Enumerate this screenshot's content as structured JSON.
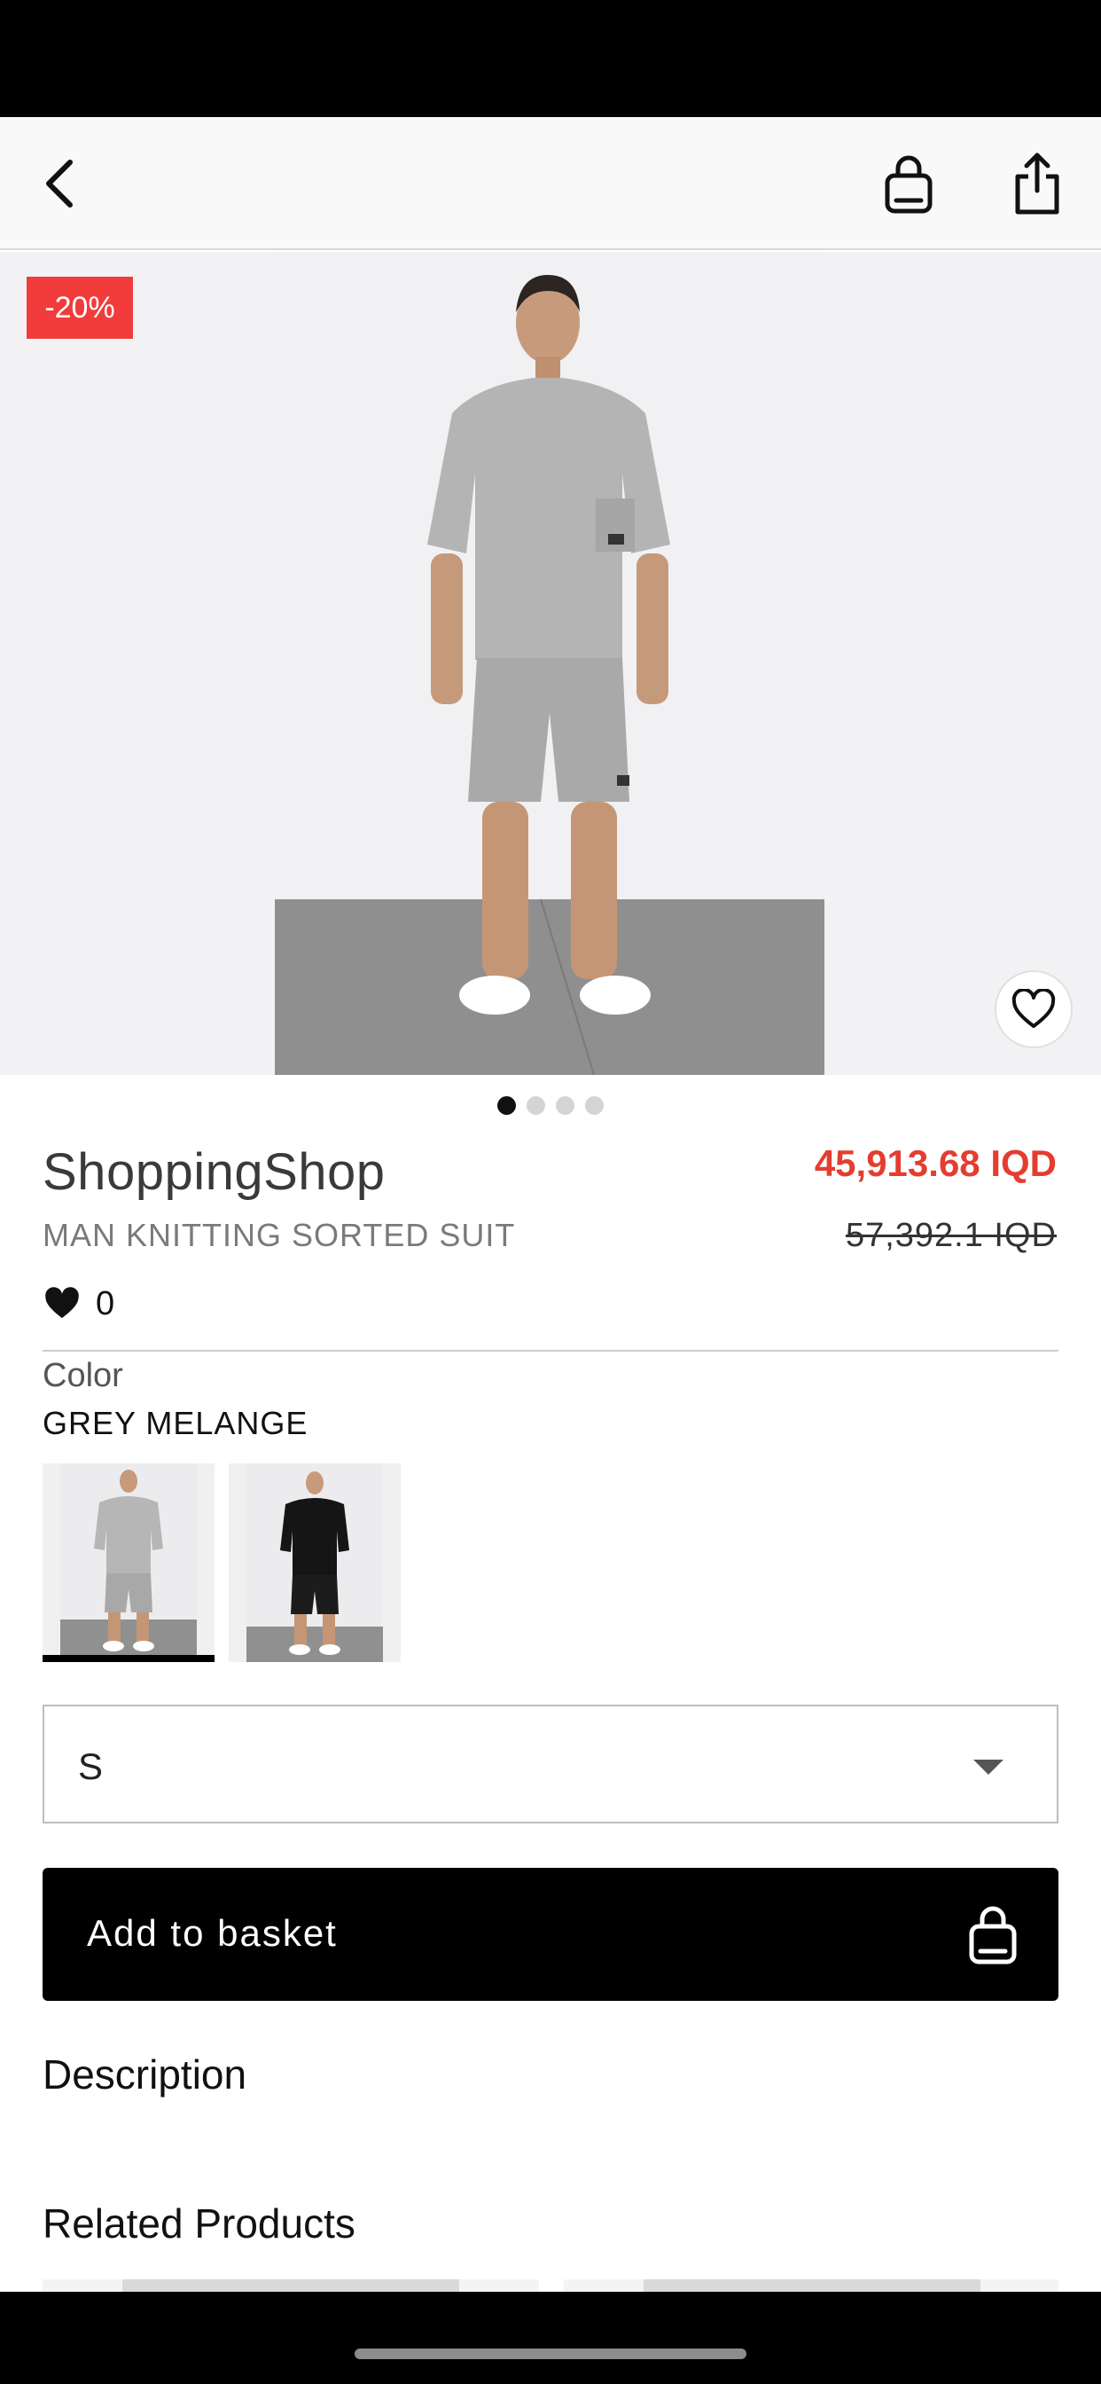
{
  "header": {
    "icons": [
      "chevron-left-icon",
      "shopping-bag-icon",
      "share-icon"
    ]
  },
  "hero": {
    "discount_badge": "-20%",
    "image_count": 4,
    "active_image": 1
  },
  "product": {
    "brand": "ShoppingShop",
    "name": "MAN KNITTING SORTED SUIT",
    "price_current": "45,913.68 IQD",
    "price_original": "57,392.1 IQD",
    "likes_count": "0"
  },
  "color": {
    "label": "Color",
    "selected": "GREY MELANGE",
    "options": [
      "grey",
      "black"
    ]
  },
  "size": {
    "selected": "S"
  },
  "actions": {
    "add_to_basket": "Add to basket"
  },
  "sections": {
    "description": "Description",
    "related_products": "Related Products"
  },
  "colors": {
    "accent_red": "#e43d30",
    "badge_red": "#f23b3b",
    "primary": "#000000"
  }
}
